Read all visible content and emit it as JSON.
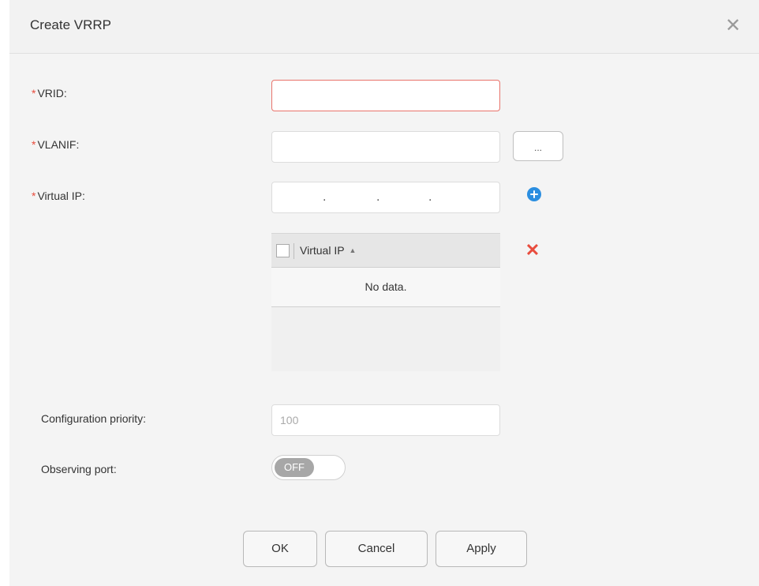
{
  "dialog": {
    "title": "Create VRRP",
    "close_glyph": "✕"
  },
  "form": {
    "vrid": {
      "label": "VRID:",
      "required_mark": "*",
      "value": ""
    },
    "vlanif": {
      "label": "VLANIF:",
      "required_mark": "*",
      "value": "",
      "browse_label": "..."
    },
    "virtual_ip": {
      "label": "Virtual IP:",
      "required_mark": "*",
      "separator": "."
    },
    "priority": {
      "label": "Configuration priority:",
      "placeholder": "100",
      "value": ""
    },
    "observing_port": {
      "label": "Observing port:",
      "toggle_text": "OFF",
      "state": "off"
    }
  },
  "table": {
    "column_header": "Virtual IP",
    "sort_glyph": "▲",
    "empty_text": "No data.",
    "rows": []
  },
  "buttons": {
    "ok": "OK",
    "cancel": "Cancel",
    "apply": "Apply"
  },
  "icons": {
    "add": "plus-circle-icon",
    "delete": "delete-x-icon",
    "close": "close-icon"
  },
  "colors": {
    "required": "#e84c3d",
    "error_border": "#e8736b",
    "add_icon": "#2b8ee0",
    "delete_icon": "#e84c3d",
    "toggle_off": "#a7a7a7"
  }
}
